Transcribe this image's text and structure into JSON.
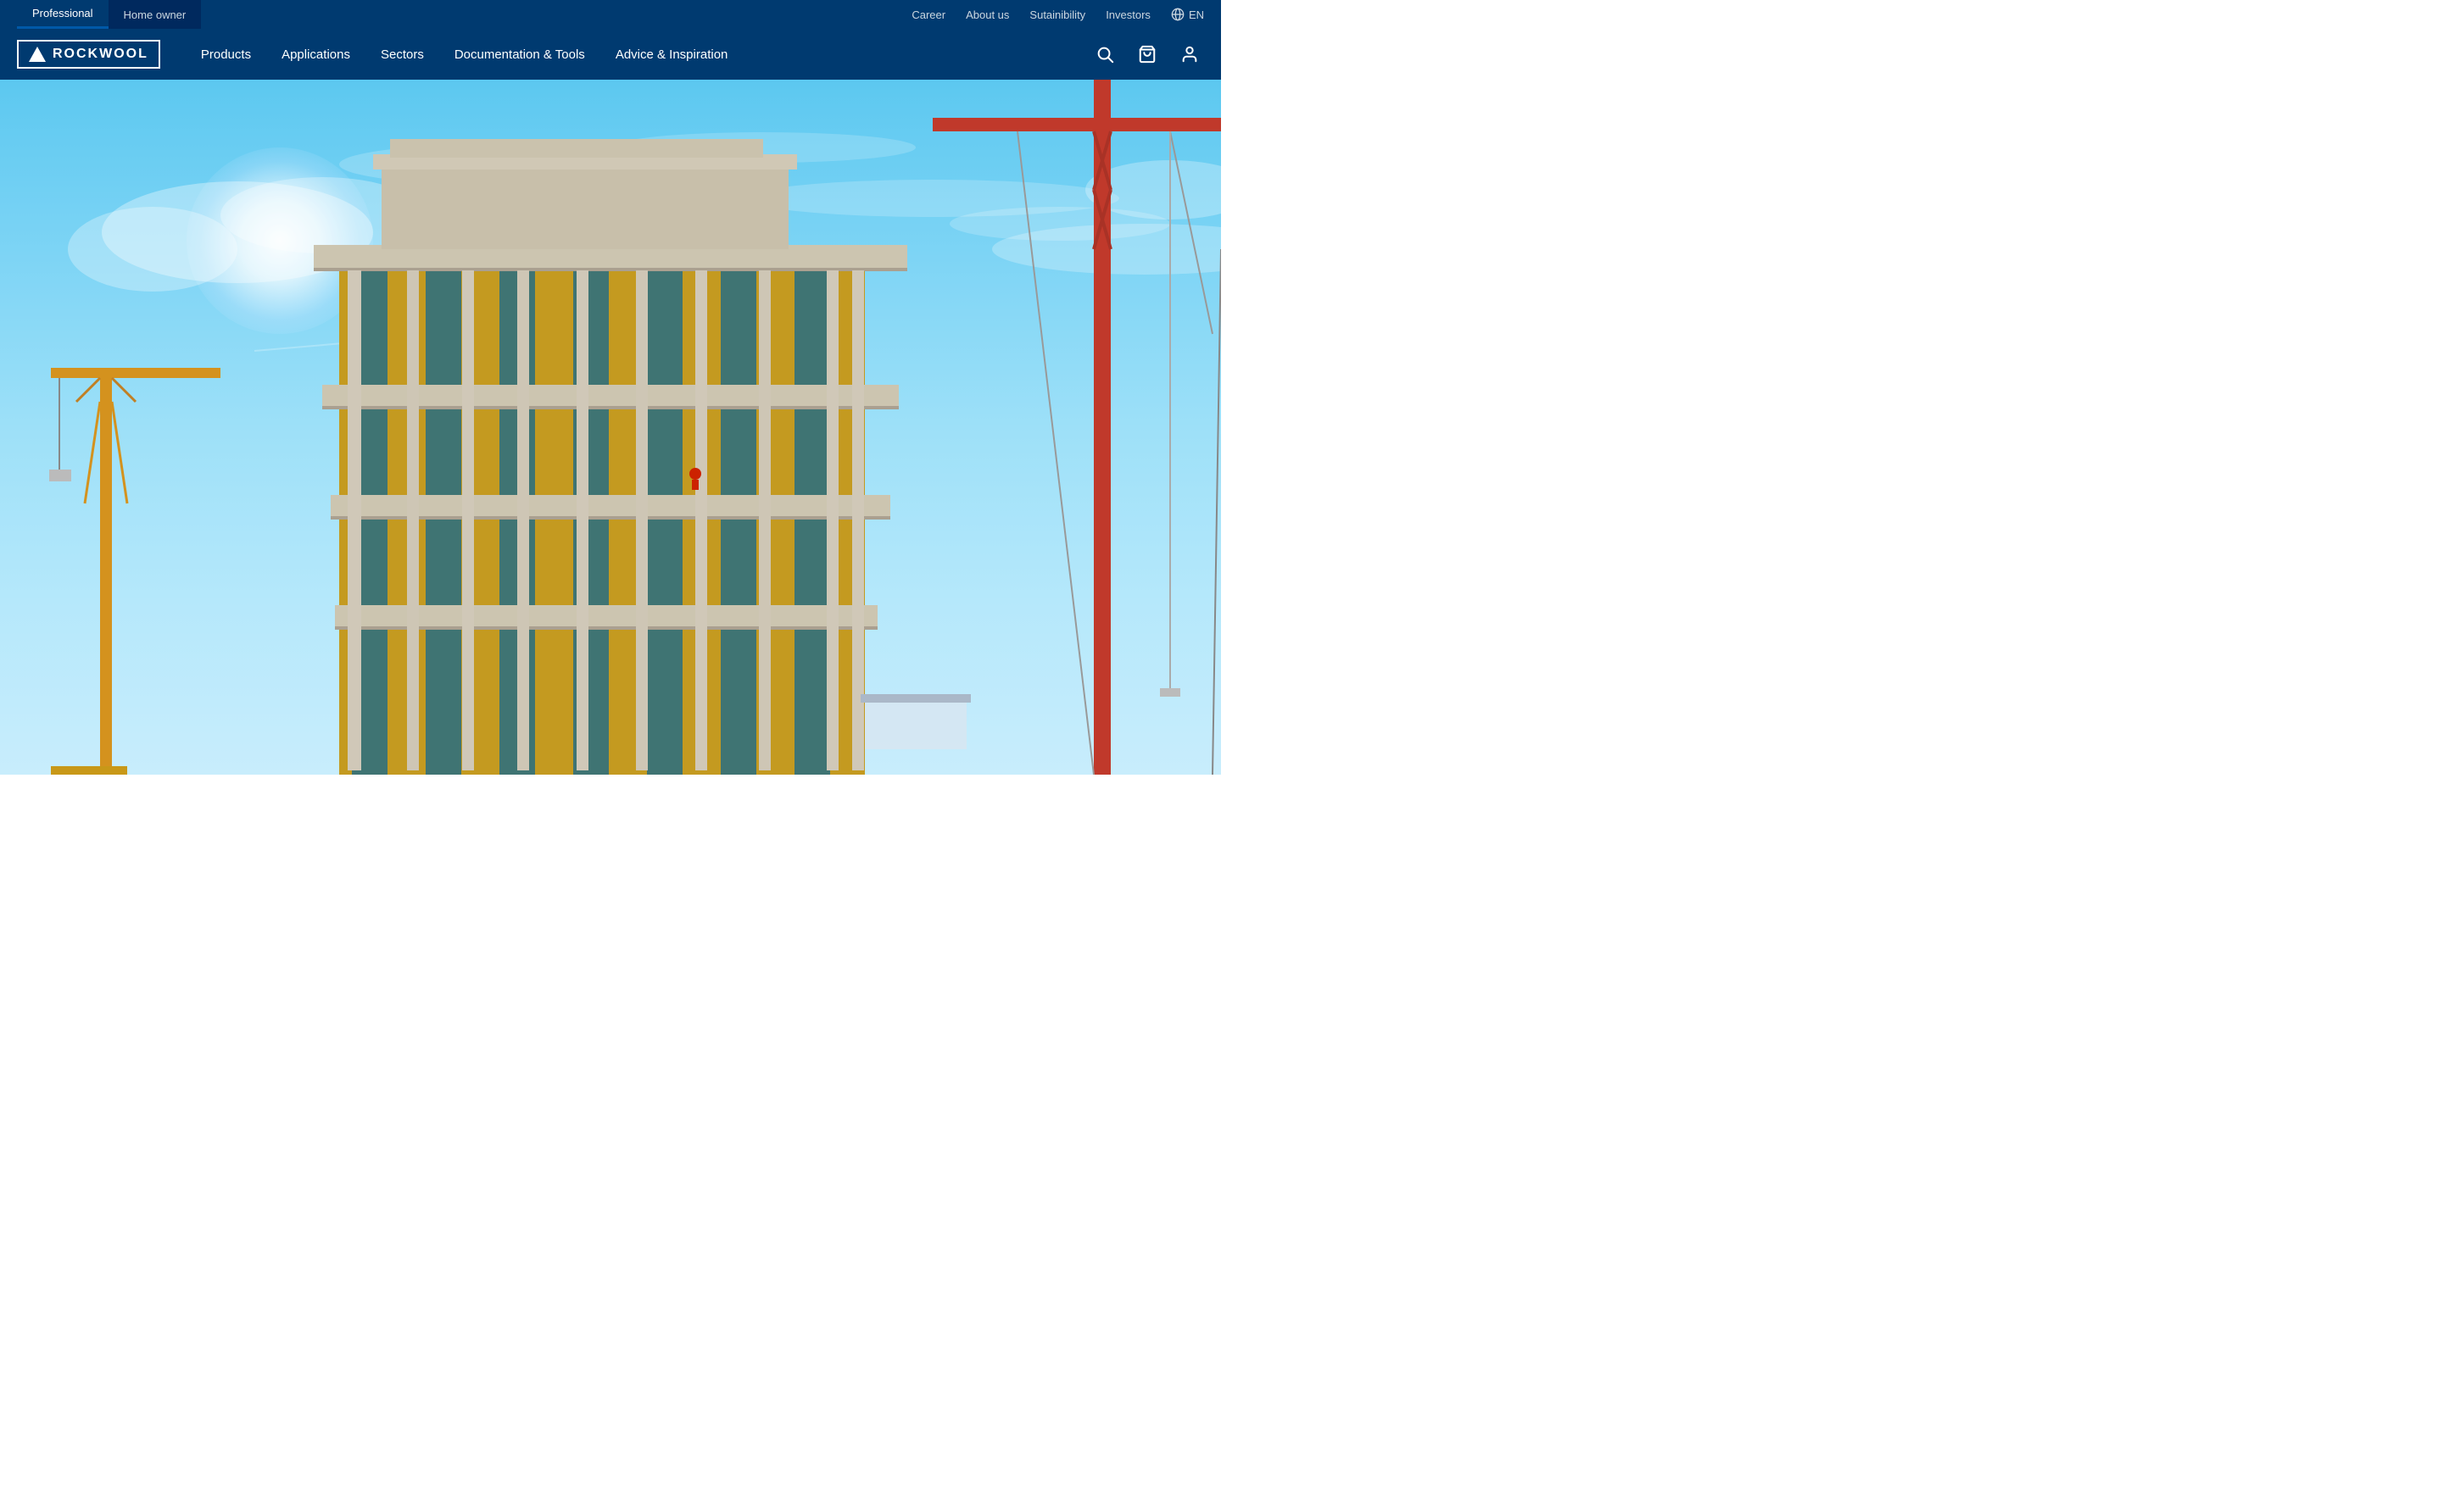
{
  "top_bar": {
    "tab_professional": "Professional",
    "tab_homeowner": "Home owner",
    "links": {
      "career": "Career",
      "about_us": "About us",
      "sustainability": "Sutainibility",
      "investors": "Investors"
    },
    "lang": "EN"
  },
  "main_nav": {
    "logo_text": "ROCKWOOL",
    "links": [
      {
        "id": "products",
        "label": "Products"
      },
      {
        "id": "applications",
        "label": "Applications"
      },
      {
        "id": "sectors",
        "label": "Sectors"
      },
      {
        "id": "documentation",
        "label": "Documentation & Tools"
      },
      {
        "id": "advice",
        "label": "Advice & Inspiration"
      }
    ]
  },
  "icons": {
    "search": "search-icon",
    "cart": "cart-icon",
    "user": "user-icon",
    "globe": "globe-icon"
  }
}
